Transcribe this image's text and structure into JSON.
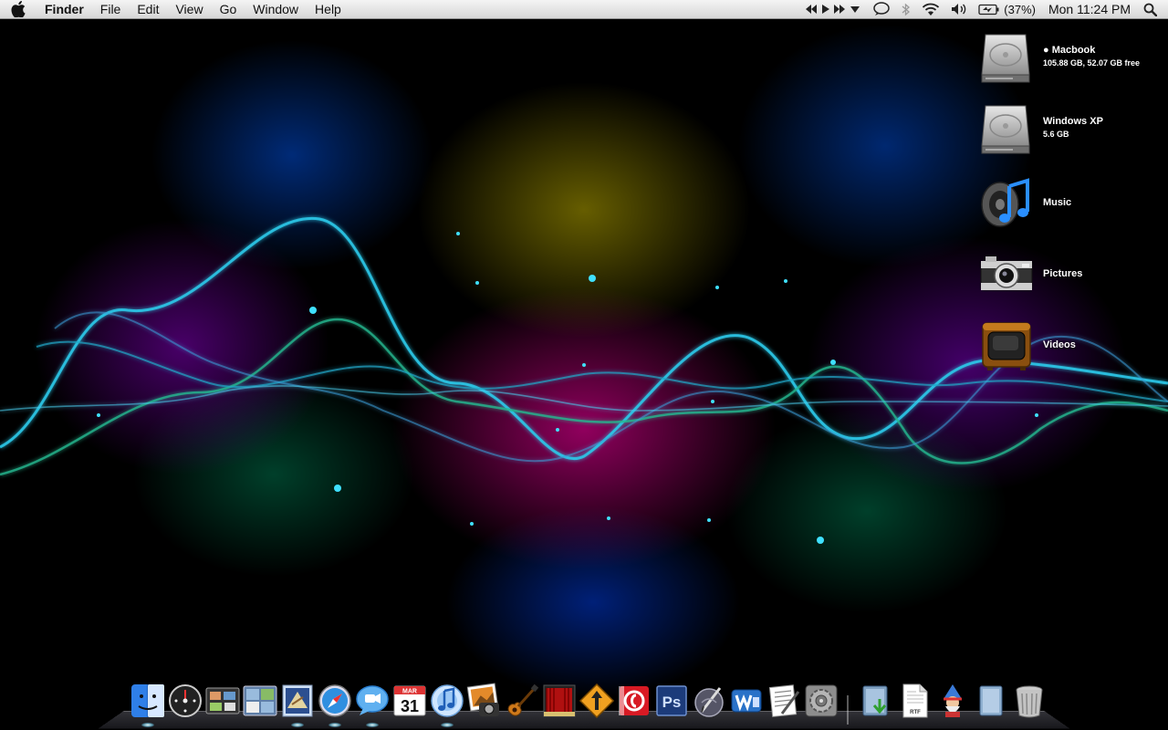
{
  "menubar": {
    "app_name": "Finder",
    "items": [
      "File",
      "Edit",
      "View",
      "Go",
      "Window",
      "Help"
    ],
    "battery_percent": "(37%)",
    "clock": "Mon 11:24 PM",
    "status_icons": [
      "rewind-icon",
      "play-icon",
      "fast-forward-icon",
      "dropdown-arrow-icon",
      "speech-bubble-icon",
      "bluetooth-icon",
      "wifi-icon",
      "volume-icon",
      "battery-icon",
      "spotlight-icon"
    ]
  },
  "desktop": {
    "icons": [
      {
        "name": "Macbook",
        "detail": "105.88 GB, 52.07 GB free",
        "icon": "hard-drive-icon"
      },
      {
        "name": "Windows XP",
        "detail": "5.6 GB",
        "icon": "hard-drive-icon"
      },
      {
        "name": "Music",
        "detail": "",
        "icon": "music-speaker-icon"
      },
      {
        "name": "Pictures",
        "detail": "",
        "icon": "camera-icon"
      },
      {
        "name": "Videos",
        "detail": "",
        "icon": "tv-icon"
      }
    ]
  },
  "dock": {
    "calendar_date": "31",
    "calendar_month": "MAR",
    "photoshop_label": "Ps",
    "rtf_label": "RTF",
    "items": [
      {
        "icon": "finder-icon",
        "running": true
      },
      {
        "icon": "dashboard-icon",
        "running": false
      },
      {
        "icon": "exposé-icon",
        "running": false
      },
      {
        "icon": "spaces-icon",
        "running": false
      },
      {
        "icon": "mail-icon",
        "running": true
      },
      {
        "icon": "safari-icon",
        "running": true
      },
      {
        "icon": "ichat-icon",
        "running": true
      },
      {
        "icon": "ical-icon",
        "running": false
      },
      {
        "icon": "itunes-icon",
        "running": true
      },
      {
        "icon": "iphoto-icon",
        "running": false
      },
      {
        "icon": "garageband-icon",
        "running": false
      },
      {
        "icon": "front-row-icon",
        "running": false
      },
      {
        "icon": "transmit-icon",
        "running": false
      },
      {
        "icon": "flash-icon",
        "running": false
      },
      {
        "icon": "photoshop-icon",
        "running": false
      },
      {
        "icon": "script-editor-icon",
        "running": false
      },
      {
        "icon": "word-icon",
        "running": false
      },
      {
        "icon": "textedit-icon",
        "running": false
      },
      {
        "icon": "system-preferences-icon",
        "running": false
      },
      {
        "icon": "downloads-stack-icon",
        "running": false
      },
      {
        "icon": "rtf-document-icon",
        "running": false
      },
      {
        "icon": "wizard-app-icon",
        "running": false
      },
      {
        "icon": "documents-stack-icon",
        "running": false
      },
      {
        "icon": "trash-icon",
        "running": false
      }
    ]
  }
}
